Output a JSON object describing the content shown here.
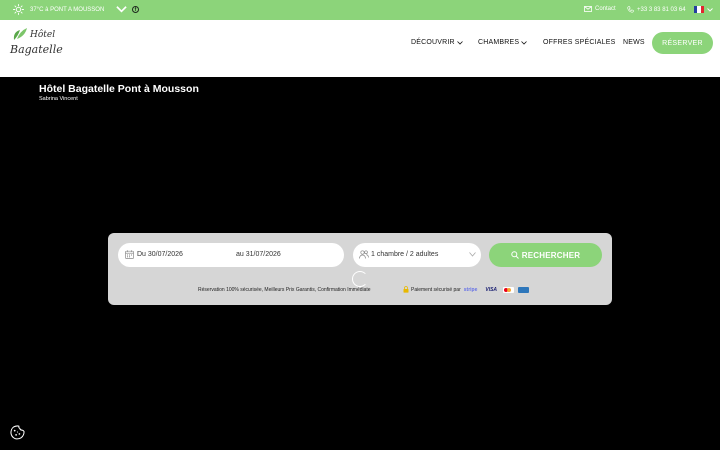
{
  "topbar": {
    "weather": "37°C à PONT A MOUSSON",
    "facebook": "f",
    "contact": "Contact",
    "phone": "+33 3 83 81 03 64"
  },
  "header": {
    "logo_line1": "Hôtel",
    "logo_line2": "Bagatelle",
    "nav": {
      "discover": "DÉCOUVRIR",
      "rooms": "CHAMBRES",
      "offers": "OFFRES SPÉCIALES",
      "news": "NEWS"
    },
    "reserve": "RÉSERVER"
  },
  "hero": {
    "title": "Hôtel Bagatelle Pont à Mousson",
    "subtitle": "Sabrina Vincent"
  },
  "booking": {
    "date_from": "Du 30/07/2026",
    "date_to": "au 31/07/2026",
    "guests": "1 chambre / 2 adultes",
    "search": "RECHERCHER",
    "secure_text": "Réservation 100% sécurisée, Meilleurs Prix Garantis, Confirmation Immédiate",
    "payment_text": "Paiement sécurisé par",
    "payment_provider": "stripe",
    "card_visa": "VISA"
  },
  "colors": {
    "accent": "#8cd47a",
    "hero_bg": "#000000",
    "panel_bg": "#d6d6d6"
  }
}
